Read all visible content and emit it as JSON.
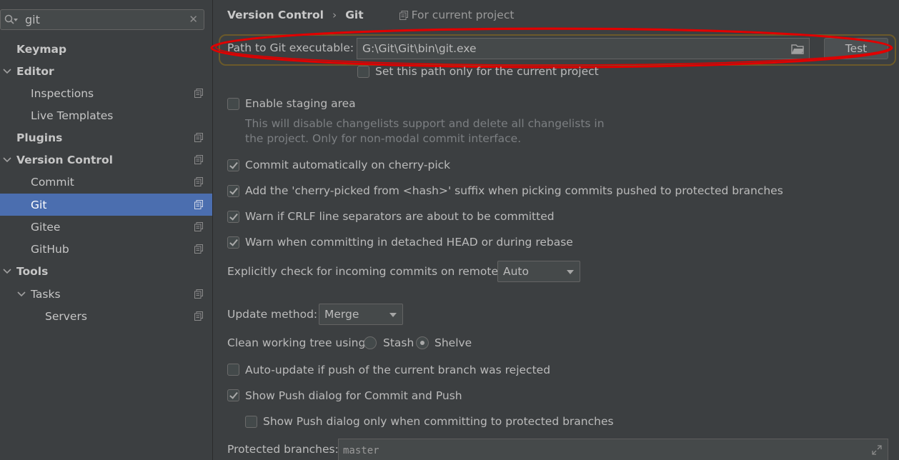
{
  "search": {
    "value": "git",
    "clear_icon": "close-icon"
  },
  "sidebar": {
    "items": [
      {
        "label": "Keymap"
      },
      {
        "label": "Editor"
      },
      {
        "label": "Inspections"
      },
      {
        "label": "Live Templates"
      },
      {
        "label": "Plugins"
      },
      {
        "label": "Version Control"
      },
      {
        "label": "Commit"
      },
      {
        "label": "Git"
      },
      {
        "label": "Gitee"
      },
      {
        "label": "GitHub"
      },
      {
        "label": "Tools"
      },
      {
        "label": "Tasks"
      },
      {
        "label": "Servers"
      }
    ],
    "selected": "Git"
  },
  "breadcrumb": {
    "parent": "Version Control",
    "separator": "›",
    "current": "Git",
    "scope": "For current project"
  },
  "git_path": {
    "label": "Path to Git executable:",
    "value": "G:\\Git\\Git\\bin\\git.exe",
    "test_label": "Test",
    "only_current_label": "Set this path only for the current project"
  },
  "staging": {
    "label": "Enable staging area",
    "desc_line1": "This will disable changelists support and delete all changelists in",
    "desc_line2": "the project. Only for non-modal commit interface."
  },
  "options": {
    "cherry_pick": "Commit automatically on cherry-pick",
    "cherry_suffix": "Add the 'cherry-picked from <hash>' suffix when picking commits pushed to protected branches",
    "crlf": "Warn if CRLF line separators are about to be committed",
    "detached": "Warn when committing in detached HEAD or during rebase"
  },
  "incoming": {
    "label": "Explicitly check for incoming commits on remotes:",
    "value": "Auto"
  },
  "update_method": {
    "label": "Update method:",
    "value": "Merge"
  },
  "clean_tree": {
    "label": "Clean working tree using:",
    "option1": "Stash",
    "option2": "Shelve",
    "selected": "Shelve"
  },
  "push": {
    "auto_update": "Auto-update if push of the current branch was rejected",
    "show_dialog": "Show Push dialog for Commit and Push",
    "only_protected": "Show Push dialog only when committing to protected branches"
  },
  "protected": {
    "label": "Protected branches:",
    "value": "master"
  },
  "colors": {
    "selection": "#4b6eaf",
    "annotation": "#e00000",
    "background": "#3c3f41"
  }
}
